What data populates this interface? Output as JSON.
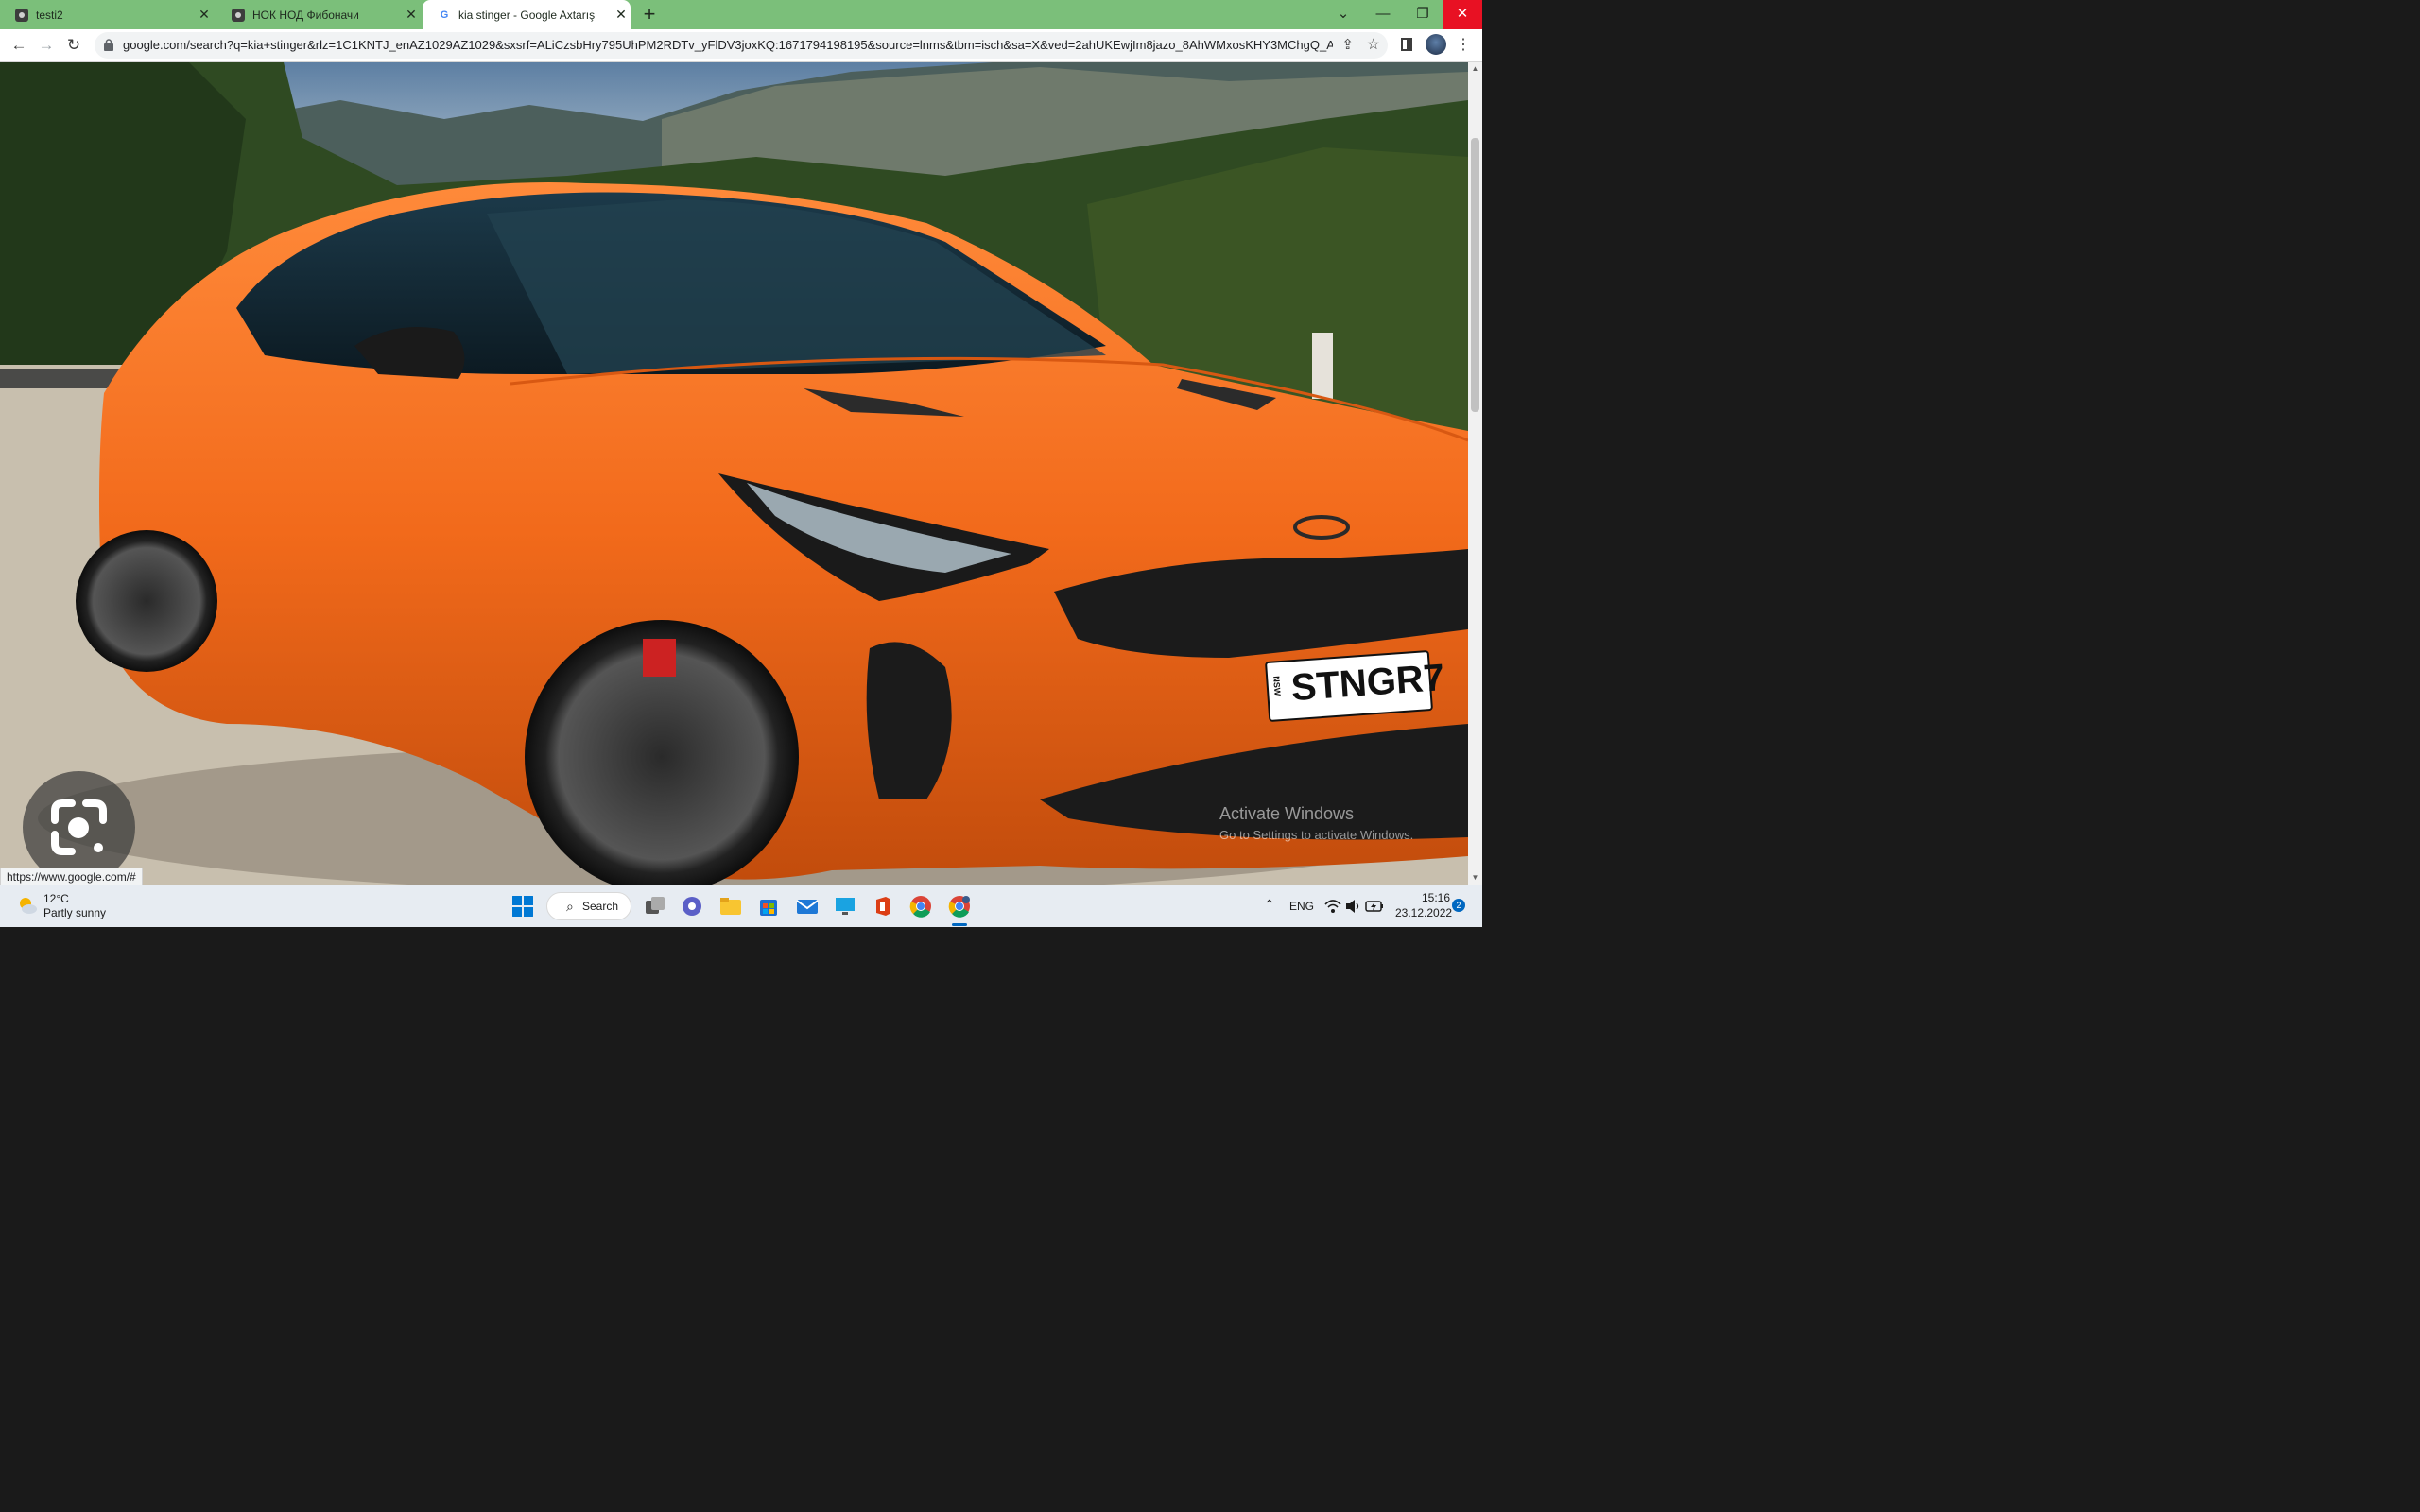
{
  "tabs": [
    {
      "title": "testi2",
      "icon": "person-icon",
      "close": "✕"
    },
    {
      "title": "НОК НОД Фибоначи",
      "icon": "person-icon",
      "close": "✕"
    },
    {
      "title": "kia stinger - Google Axtarış",
      "icon": "google-icon",
      "close": "✕",
      "active": true
    }
  ],
  "new_tab": "+",
  "window_controls": {
    "list": "⌄",
    "minimize": "—",
    "restore": "❐",
    "close": "✕"
  },
  "toolbar": {
    "back": "←",
    "forward": "→",
    "reload": "↻",
    "url": "google.com/search?q=kia+stinger&rlz=1C1KNTJ_enAZ1029AZ1029&sxsrf=ALiCzsbHry795UhPM2RDTv_yFlDV3joxKQ:1671794198195&source=lnms&tbm=isch&sa=X&ved=2ahUKEwjIm8jazo_8AhWMxosKHY3MChgQ_AUoA...",
    "share": "⇪",
    "bookmark": "☆",
    "menu": "⋮"
  },
  "image": {
    "plate_state": "NSW",
    "plate_number": "STNGR7",
    "car_color": "#f26a1b"
  },
  "status_url": "https://www.google.com/#",
  "watermark": {
    "line1": "Activate Windows",
    "line2": "Go to Settings to activate Windows."
  },
  "taskbar": {
    "temperature": "12°C",
    "weather": "Partly sunny",
    "search_label": "Search",
    "language": "ENG",
    "time": "15:16",
    "date": "23.12.2022",
    "notifications": "2"
  },
  "colors": {
    "tab_strip": "#7bbf7a",
    "accent": "#0067c0",
    "close_red": "#e81123"
  }
}
